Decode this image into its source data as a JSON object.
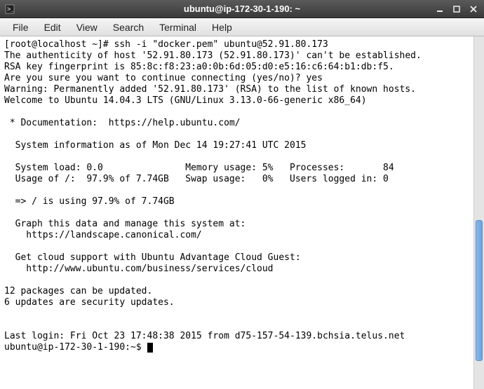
{
  "window": {
    "title": "ubuntu@ip-172-30-1-190: ~"
  },
  "menu": {
    "file": "File",
    "edit": "Edit",
    "view": "View",
    "search": "Search",
    "terminal": "Terminal",
    "help": "Help"
  },
  "terminal": {
    "line1": "[root@localhost ~]# ssh -i \"docker.pem\" ubuntu@52.91.80.173",
    "line2": "The authenticity of host '52.91.80.173 (52.91.80.173)' can't be established.",
    "line3": "RSA key fingerprint is 85:8c:f8:23:a0:0b:6d:05:d0:e5:16:c6:64:b1:db:f5.",
    "line4": "Are you sure you want to continue connecting (yes/no)? yes",
    "line5": "Warning: Permanently added '52.91.80.173' (RSA) to the list of known hosts.",
    "line6": "Welcome to Ubuntu 14.04.3 LTS (GNU/Linux 3.13.0-66-generic x86_64)",
    "line7": "",
    "line8": " * Documentation:  https://help.ubuntu.com/",
    "line9": "",
    "line10": "  System information as of Mon Dec 14 19:27:41 UTC 2015",
    "line11": "",
    "line12": "  System load: 0.0               Memory usage: 5%   Processes:       84",
    "line13": "  Usage of /:  97.9% of 7.74GB   Swap usage:   0%   Users logged in: 0",
    "line14": "",
    "line15": "  => / is using 97.9% of 7.74GB",
    "line16": "",
    "line17": "  Graph this data and manage this system at:",
    "line18": "    https://landscape.canonical.com/",
    "line19": "",
    "line20": "  Get cloud support with Ubuntu Advantage Cloud Guest:",
    "line21": "    http://www.ubuntu.com/business/services/cloud",
    "line22": "",
    "line23": "12 packages can be updated.",
    "line24": "6 updates are security updates.",
    "line25": "",
    "line26": "",
    "line27": "Last login: Fri Oct 23 17:48:38 2015 from d75-157-54-139.bchsia.telus.net",
    "prompt": "ubuntu@ip-172-30-1-190:~$ "
  }
}
